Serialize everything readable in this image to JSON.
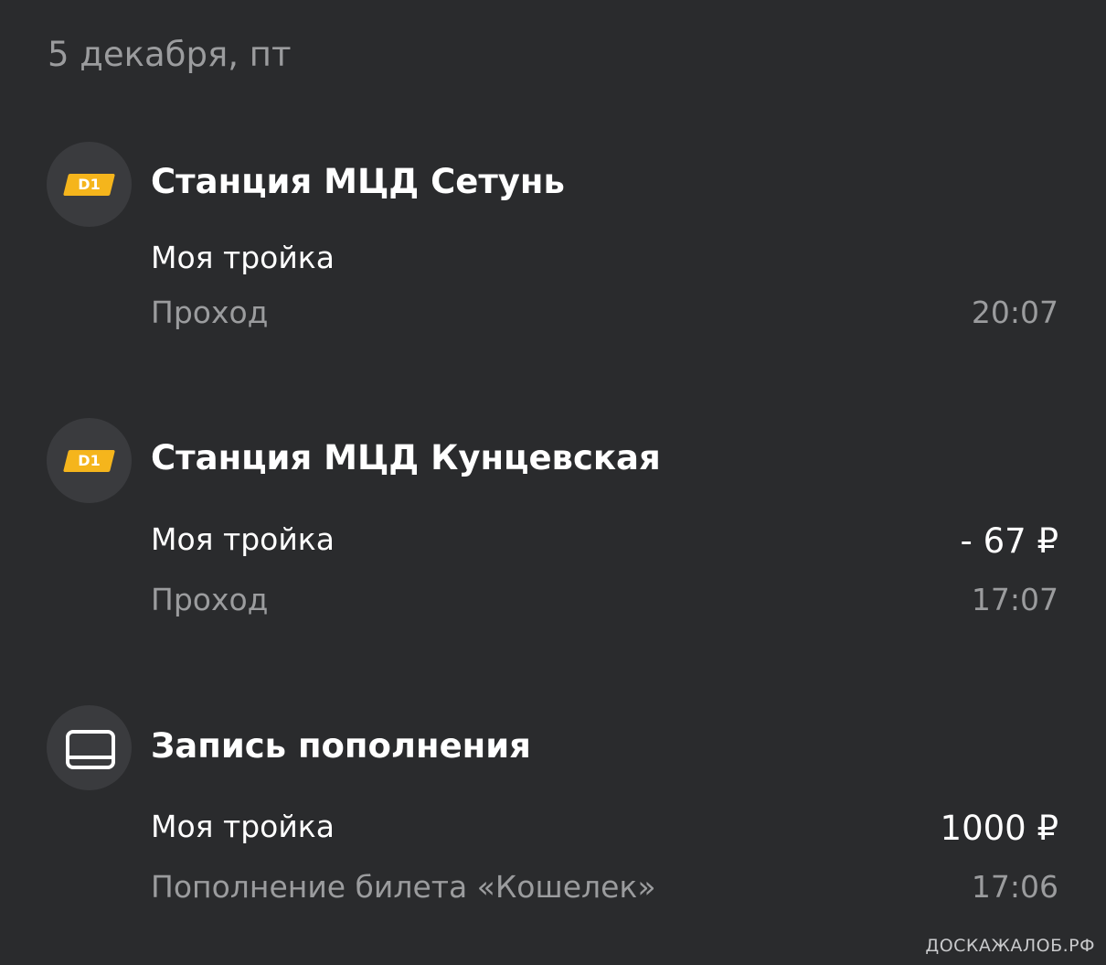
{
  "date_header": "5 декабря, пт",
  "transactions": [
    {
      "icon": "mcd-d1-icon",
      "badge": "D1",
      "title": "Станция МЦД Сетунь",
      "card": "Моя тройка",
      "amount": "",
      "type": "Проход",
      "time": "20:07"
    },
    {
      "icon": "mcd-d1-icon",
      "badge": "D1",
      "title": "Станция МЦД Кунцевская",
      "card": "Моя тройка",
      "amount": "- 67 ₽",
      "type": "Проход",
      "time": "17:07"
    },
    {
      "icon": "card-icon",
      "badge": "",
      "title": "Запись пополнения",
      "card": "Моя тройка",
      "amount": "1000 ₽",
      "type": "Пополнение билета «Кошелек»",
      "time": "17:06"
    }
  ],
  "watermark": "ДОСКАЖАЛОБ.РФ",
  "colors": {
    "background": "#2a2b2d",
    "icon_circle": "#3a3b3e",
    "d1_badge": "#f5b51c",
    "primary_text": "#ffffff",
    "secondary_text": "#9b9c9e"
  }
}
